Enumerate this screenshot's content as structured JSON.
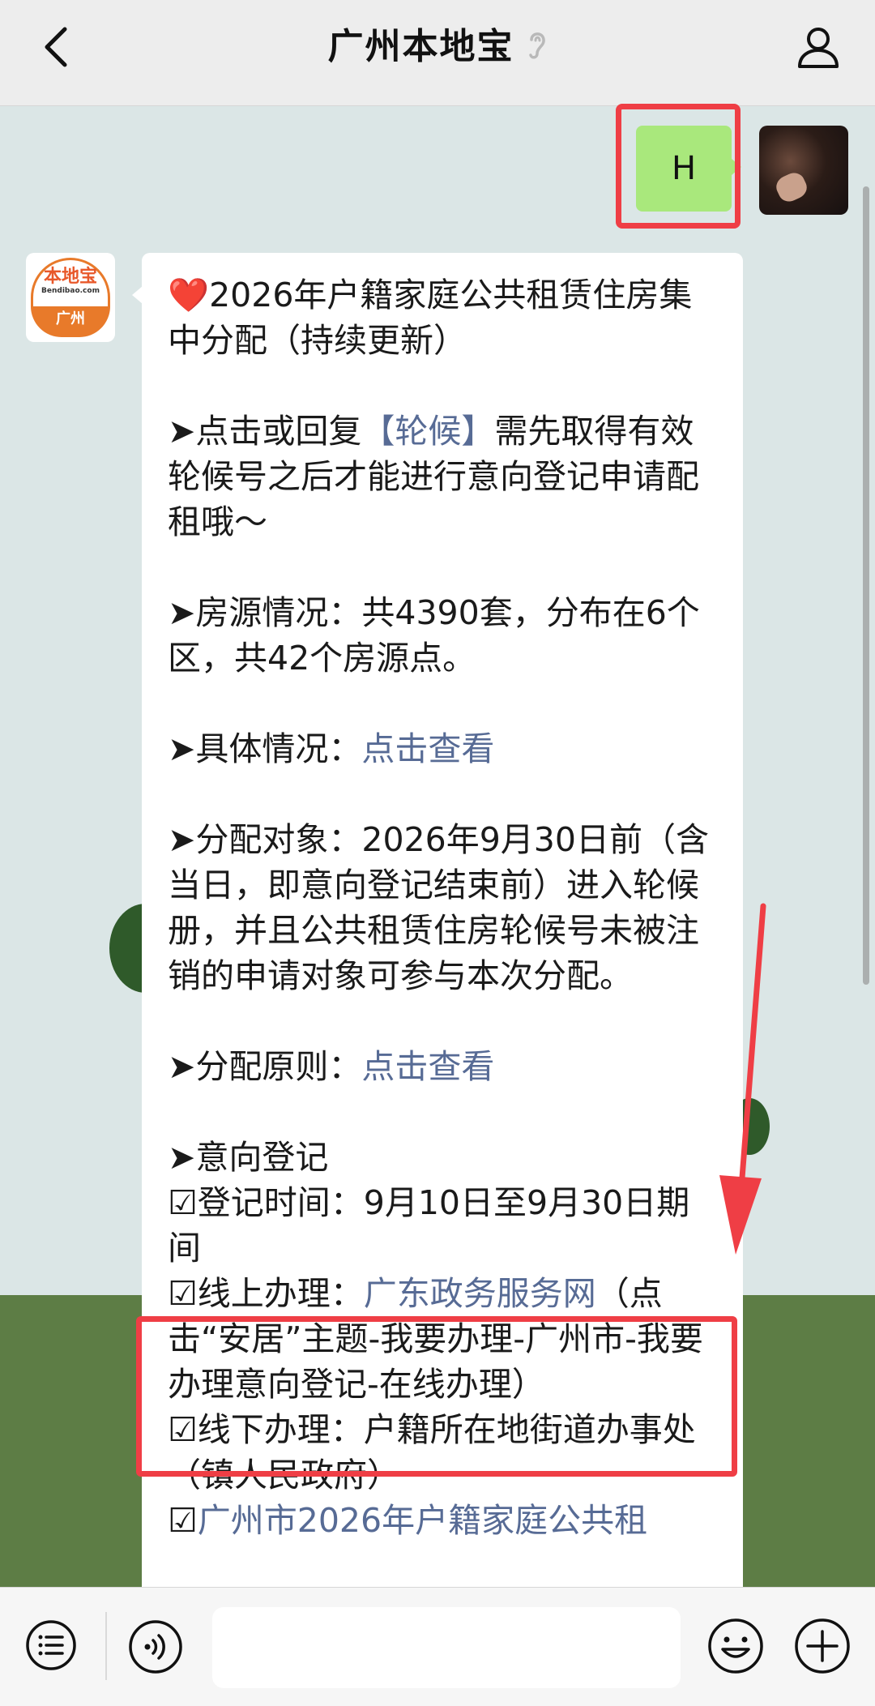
{
  "header": {
    "title": "广州本地宝",
    "back_icon": "chevron-left-icon",
    "mode_icon": "ear-icon",
    "profile_icon": "person-icon"
  },
  "sent_message": {
    "text": "H"
  },
  "official_account": {
    "logo_main": "本地宝",
    "logo_sub": "Bendibao.com",
    "logo_city": "广州"
  },
  "received_message": {
    "heading_emoji": "❤️",
    "heading": "2026年户籍家庭公共租赁住房集中分配（持续更新）",
    "item1_prefix": "➤点击或回复",
    "item1_link": "【轮候】",
    "item1_suffix": "需先取得有效轮候号之后才能进行意向登记申请配租哦～",
    "item2": "➤房源情况：共4390套，分布在6个区，共42个房源点。",
    "item3_prefix": "➤具体情况：",
    "item3_link": "点击查看",
    "item4": "➤分配对象：2026年9月30日前（含当日，即意向登记结束前）进入轮候册，并且公共租赁住房轮候号未被注销的申请对象可参与本次分配。",
    "item5_prefix": "➤分配原则：",
    "item5_link": "点击查看",
    "item6_title": "➤意向登记",
    "reg_time": "☑登记时间：9月10日至9月30日期间",
    "online_prefix": "☑线上办理：",
    "online_link": "广东政务服务网",
    "online_suffix": "（点击“安居”主题-我要办理-广州市-我要办理意向登记-在线办理）",
    "offline": "☑线下办理：户籍所在地街道办事处（镇人民政府）",
    "last_prefix": "☑",
    "last_link": "广州市2026年户籍家庭公共租"
  },
  "bottombar": {
    "menu_icon": "menu-list-icon",
    "voice_icon": "voice-icon",
    "input_value": "",
    "emoji_icon": "smiley-icon",
    "plus_icon": "plus-circle-icon"
  },
  "colors": {
    "link": "#576b95",
    "highlight": "#ef3e45",
    "sent_bubble": "#a9e87c"
  }
}
